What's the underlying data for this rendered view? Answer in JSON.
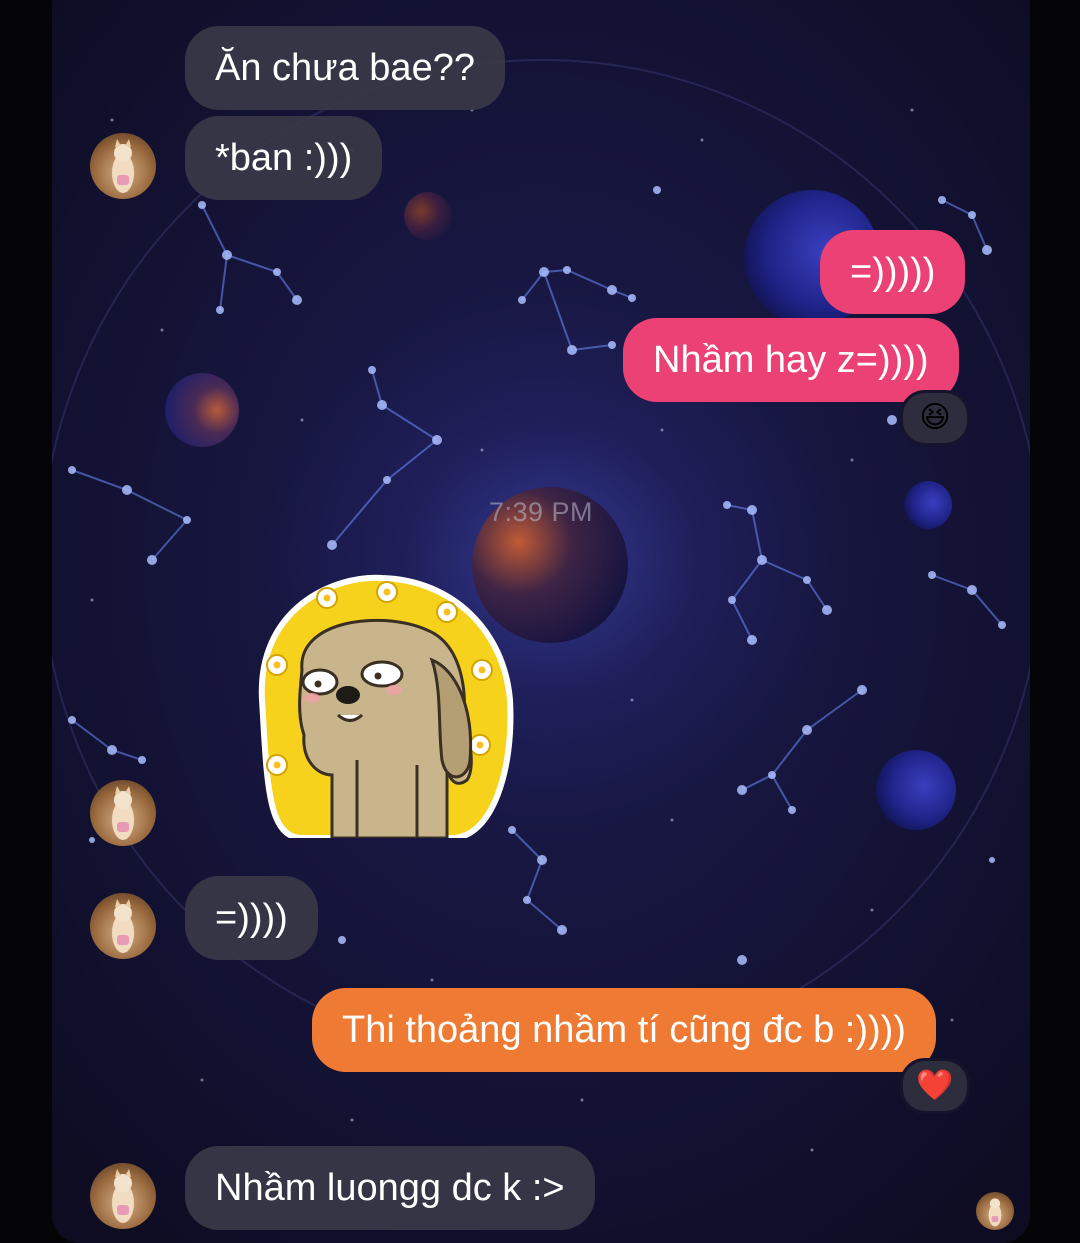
{
  "timestamp": "7:39 PM",
  "messages": [
    {
      "id": "m1",
      "side": "received",
      "text": "Ăn chưa bae??"
    },
    {
      "id": "m2",
      "side": "received",
      "text": "*ban :)))"
    },
    {
      "id": "m3",
      "side": "sent",
      "text": "=)))))"
    },
    {
      "id": "m4",
      "side": "sent",
      "text": "Nhầm hay z=))))",
      "reaction": "😆"
    },
    {
      "id": "m5",
      "side": "received",
      "type": "sticker",
      "sticker": "yellow-flower-dog-sticker"
    },
    {
      "id": "m6",
      "side": "received",
      "text": "=))))"
    },
    {
      "id": "m7",
      "side": "sent",
      "text": "Thi thoảng nhầm tí cũng đc b :))))",
      "reaction": "❤️"
    },
    {
      "id": "m8",
      "side": "received",
      "text": "Nhầm luongg dc k :>"
    }
  ],
  "colors": {
    "sent_pink": "#ec4174",
    "sent_orange": "#ee7a33",
    "received_bubble": "#3a3848",
    "background": "#15143a"
  },
  "icons": {
    "avatar": "cat-photo-avatar",
    "read_receipt": "seen-avatar-icon"
  }
}
